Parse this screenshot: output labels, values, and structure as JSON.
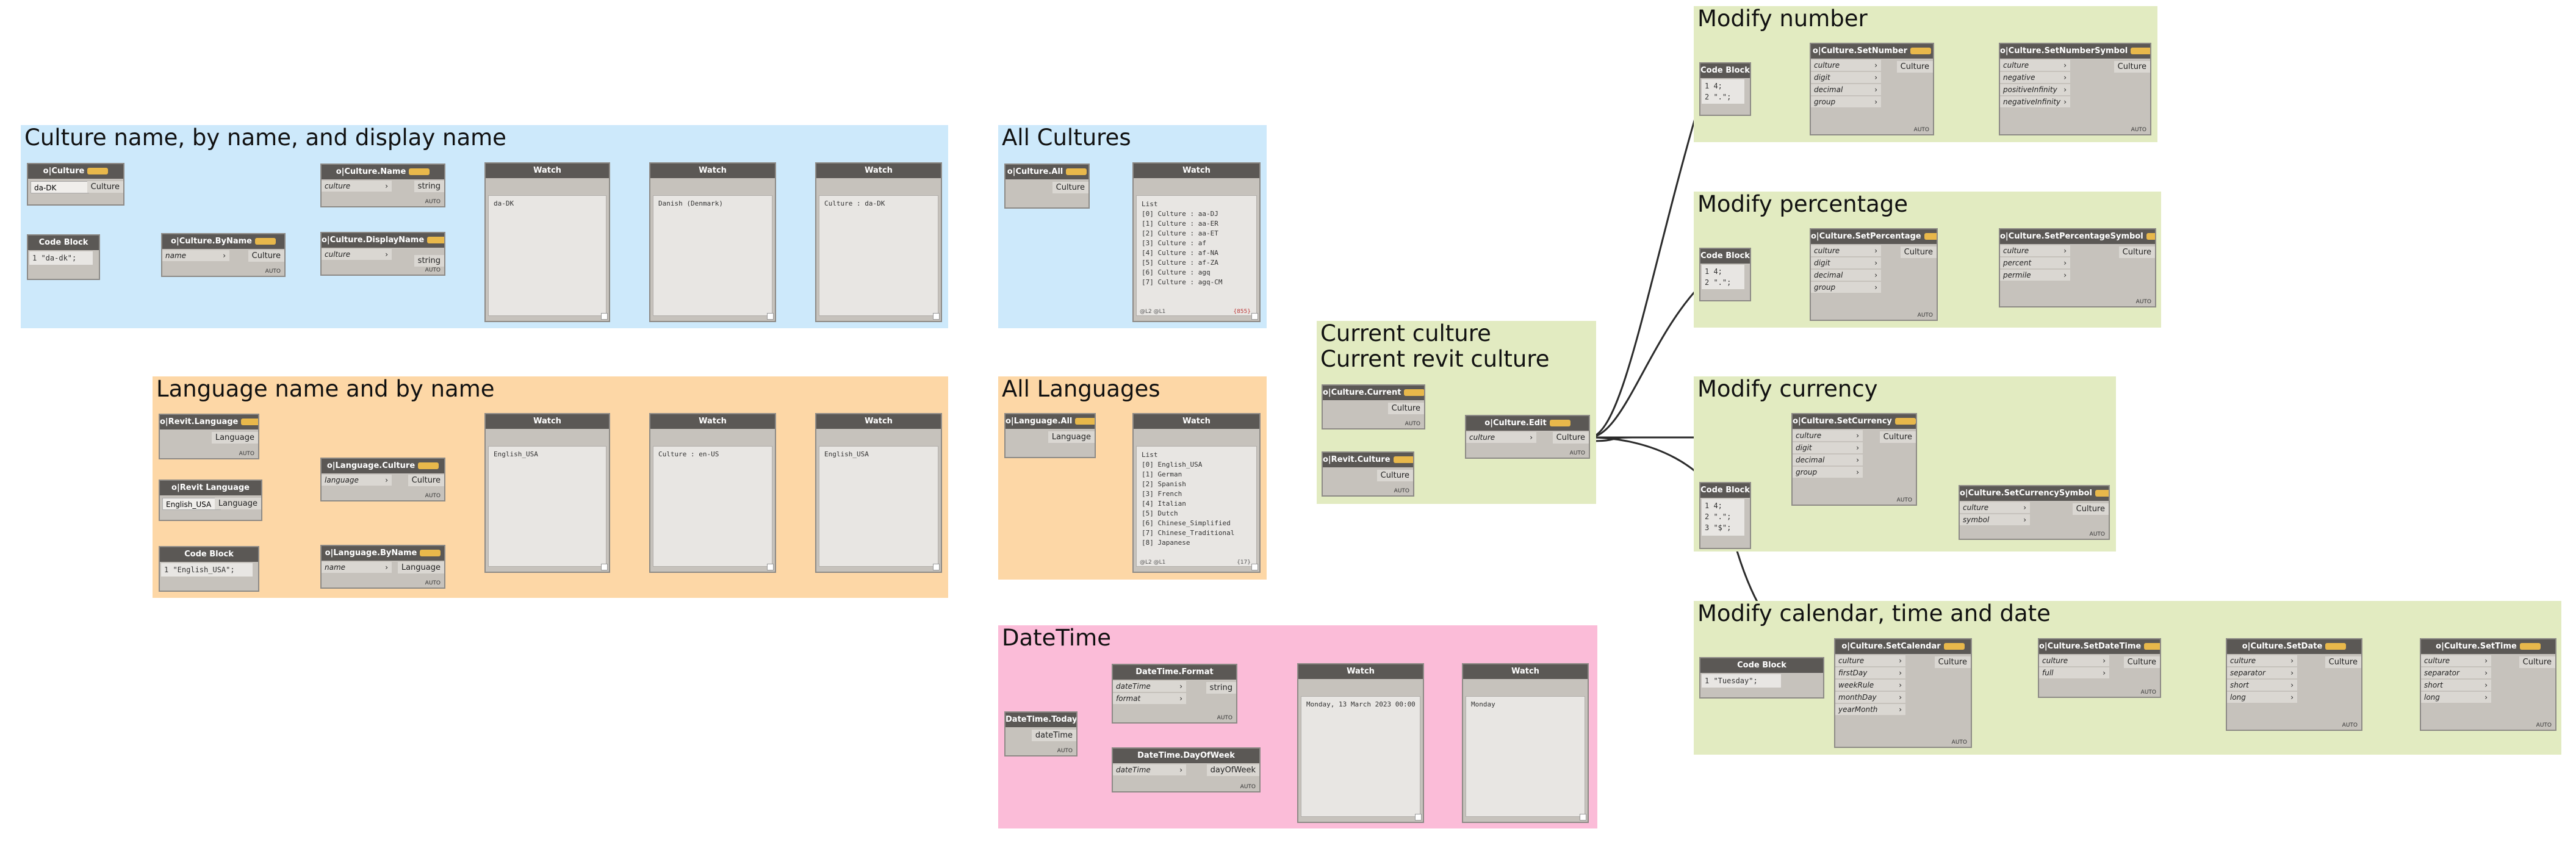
{
  "groups": {
    "culture_name": {
      "title": "Culture name, by name, and display name",
      "color": "#cde9fb"
    },
    "all_cultures": {
      "title": "All Cultures",
      "color": "#cde9fb"
    },
    "language_name": {
      "title": "Language name and by name",
      "color": "#fdd7a6"
    },
    "all_languages": {
      "title": "All Languages",
      "color": "#fdd7a6"
    },
    "current_culture": {
      "title": "Current culture\nCurrent revit culture",
      "color": "#e2ebc1"
    },
    "datetime": {
      "title": "DateTime",
      "color": "#fbbcd8"
    },
    "modify_number": {
      "title": "Modify number",
      "color": "#e2ebc1"
    },
    "modify_percentage": {
      "title": "Modify percentage",
      "color": "#e2ebc1"
    },
    "modify_currency": {
      "title": "Modify currency",
      "color": "#e2ebc1"
    },
    "modify_calendar": {
      "title": "Modify calendar, time and date",
      "color": "#e2ebc1"
    }
  },
  "common": {
    "auto": "AUTO",
    "watch": "Watch",
    "code_block": "Code Block"
  },
  "nodes": {
    "culture_dd": {
      "title": "o|Culture",
      "value": "da-DK",
      "output": "Culture"
    },
    "cb_da": {
      "code": "1 \"da-dk\";"
    },
    "culture_byname": {
      "title": "o|Culture.ByName",
      "input": "name",
      "output": "Culture"
    },
    "culture_name": {
      "title": "o|Culture.Name",
      "input": "culture",
      "output": "string"
    },
    "culture_displayname": {
      "title": "o|Culture.DisplayName",
      "input": "culture",
      "output": "string"
    },
    "watch1": {
      "text": "da-DK"
    },
    "watch2": {
      "text": "Danish (Denmark)"
    },
    "watch3": {
      "text": "Culture : da-DK"
    },
    "culture_all": {
      "title": "o|Culture.All",
      "output": "Culture"
    },
    "watch_all_cultures": {
      "items": [
        "List",
        "[0] Culture : aa-DJ",
        "[1] Culture : aa-ER",
        "[2] Culture : aa-ET",
        "[3] Culture : af",
        "[4] Culture : af-NA",
        "[5] Culture : af-ZA",
        "[6] Culture : agq",
        "[7] Culture : agq-CM"
      ],
      "footer_left": "@L2 @L1",
      "footer_right": "{855}"
    },
    "revit_language": {
      "title": "o|Revit.Language",
      "output": "Language"
    },
    "revit_language_dd": {
      "title": "o|Revit Language",
      "value": "English_USA",
      "output": "Language"
    },
    "cb_english": {
      "code": "1 \"English_USA\";"
    },
    "language_culture": {
      "title": "o|Language.Culture",
      "input": "language",
      "output": "Culture"
    },
    "language_byname": {
      "title": "o|Language.ByName",
      "input": "name",
      "output": "Language"
    },
    "watch4": {
      "text": "English_USA"
    },
    "watch5": {
      "text": "Culture : en-US"
    },
    "watch6": {
      "text": "English_USA"
    },
    "language_all": {
      "title": "o|Language.All",
      "output": "Language"
    },
    "watch_all_languages": {
      "items": [
        "List",
        "[0] English_USA",
        "[1] German",
        "[2] Spanish",
        "[3] French",
        "[4] Italian",
        "[5] Dutch",
        "[6] Chinese_Simplified",
        "[7] Chinese_Traditional",
        "[8] Japanese"
      ],
      "footer_left": "@L2 @L1",
      "footer_right": "{17}"
    },
    "culture_current": {
      "title": "o|Culture.Current",
      "output": "Culture"
    },
    "revit_culture": {
      "title": "o|Revit.Culture",
      "output": "Culture"
    },
    "culture_edit": {
      "title": "o|Culture.Edit",
      "input": "culture",
      "output": "Culture"
    },
    "datetime_today": {
      "title": "DateTime.Today",
      "output": "dateTime"
    },
    "datetime_format": {
      "title": "DateTime.Format",
      "inputs": [
        "dateTime",
        "format"
      ],
      "output": "string"
    },
    "datetime_dow": {
      "title": "DateTime.DayOfWeek",
      "input": "dateTime",
      "output": "dayOfWeek"
    },
    "watch7": {
      "text": "Monday, 13 March 2023 00:00"
    },
    "watch8": {
      "text": "Monday"
    },
    "cb_number": {
      "code": "1 4;\n2 \".\";"
    },
    "set_number": {
      "title": "o|Culture.SetNumber",
      "inputs": [
        "culture",
        "digit",
        "decimal",
        "group"
      ],
      "output": "Culture"
    },
    "set_number_symbol": {
      "title": "o|Culture.SetNumberSymbol",
      "inputs": [
        "culture",
        "negative",
        "positiveInfinity",
        "negativeInfinity"
      ],
      "output": "Culture"
    },
    "cb_percentage": {
      "code": "1 4;\n2 \".\";"
    },
    "set_percentage": {
      "title": "o|Culture.SetPercentage",
      "inputs": [
        "culture",
        "digit",
        "decimal",
        "group"
      ],
      "output": "Culture"
    },
    "set_percentage_symbol": {
      "title": "o|Culture.SetPercentageSymbol",
      "inputs": [
        "culture",
        "percent",
        "permile"
      ],
      "output": "Culture"
    },
    "cb_currency": {
      "code": "1 4;\n2 \".\";\n3 \"$\";"
    },
    "set_currency": {
      "title": "o|Culture.SetCurrency",
      "inputs": [
        "culture",
        "digit",
        "decimal",
        "group"
      ],
      "output": "Culture"
    },
    "set_currency_symbol": {
      "title": "o|Culture.SetCurrencySymbol",
      "inputs": [
        "culture",
        "symbol"
      ],
      "output": "Culture"
    },
    "cb_calendar": {
      "code": "1 \"Tuesday\";"
    },
    "set_calendar": {
      "title": "o|Culture.SetCalendar",
      "inputs": [
        "culture",
        "firstDay",
        "weekRule",
        "monthDay",
        "yearMonth"
      ],
      "output": "Culture"
    },
    "set_datetime": {
      "title": "o|Culture.SetDateTime",
      "inputs": [
        "culture",
        "full"
      ],
      "output": "Culture"
    },
    "set_date": {
      "title": "o|Culture.SetDate",
      "inputs": [
        "culture",
        "separator",
        "short",
        "long"
      ],
      "output": "Culture"
    },
    "set_time": {
      "title": "o|Culture.SetTime",
      "inputs": [
        "culture",
        "separator",
        "short",
        "long"
      ],
      "output": "Culture"
    }
  }
}
